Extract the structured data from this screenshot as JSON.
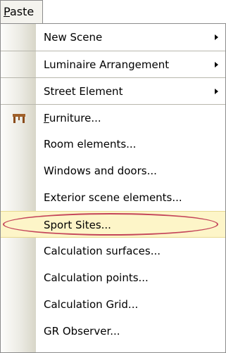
{
  "menubar": {
    "tab_label_mnemonic": "P",
    "tab_label_rest": "aste"
  },
  "menu": {
    "items": [
      {
        "label": "New Scene",
        "submenu": true
      },
      {
        "label": "Luminaire Arrangement",
        "submenu": true
      },
      {
        "label": "Street Element",
        "submenu": true
      },
      {
        "label": "Furniture...",
        "mnemonic": "F",
        "rest": "urniture...",
        "icon": "furniture-table-icon"
      },
      {
        "label": "Room elements..."
      },
      {
        "label": "Windows and doors..."
      },
      {
        "label": "Exterior scene elements..."
      },
      {
        "label": "Sport Sites...",
        "highlighted": true,
        "annotated": true
      },
      {
        "label": "Calculation surfaces..."
      },
      {
        "label": "Calculation points..."
      },
      {
        "label": "Calculation Grid..."
      },
      {
        "label": "GR Observer..."
      }
    ]
  },
  "colors": {
    "highlight_bg": "#fdf5c8",
    "annotation_ellipse": "#c4455a",
    "gutter": "#ecebe4"
  }
}
